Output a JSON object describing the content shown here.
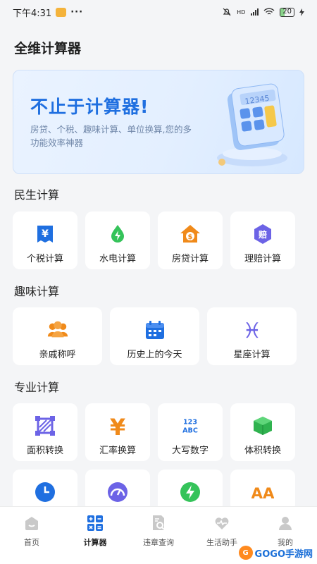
{
  "status": {
    "time": "下午4:31",
    "more": "···",
    "signal_label": "HD",
    "battery": "20"
  },
  "app": {
    "title": "全维计算器"
  },
  "banner": {
    "title": "不止于计算器!",
    "subtitle": "房贷、个税、趣味计算、单位换算,您的多功能效率神器",
    "display_text": "12345"
  },
  "sections": {
    "minsheng": {
      "title": "民生计算",
      "items": [
        {
          "label": "个税计算",
          "icon": "tax-icon",
          "color": "#1f6fe0",
          "glyph": "¥"
        },
        {
          "label": "水电计算",
          "icon": "utility-icon",
          "color": "#35c35a",
          "glyph": "⚡"
        },
        {
          "label": "房贷计算",
          "icon": "mortgage-icon",
          "color": "#f08a1a",
          "glyph": "$"
        },
        {
          "label": "理赔计算",
          "icon": "claim-icon",
          "color": "#6c63e6",
          "glyph": "赔"
        }
      ]
    },
    "quwei": {
      "title": "趣味计算",
      "items": [
        {
          "label": "亲戚称呼",
          "icon": "relatives-icon",
          "color": "#f08a1a"
        },
        {
          "label": "历史上的今天",
          "icon": "calendar-icon",
          "color": "#1f6fe0"
        },
        {
          "label": "星座计算",
          "icon": "pisces-icon",
          "color": "#6c63e6",
          "glyph": "♓"
        }
      ]
    },
    "zhuanye": {
      "title": "专业计算",
      "items": [
        {
          "label": "面积转换",
          "icon": "area-icon",
          "color": "#6c63e6"
        },
        {
          "label": "汇率换算",
          "icon": "exchange-icon",
          "color": "#f08a1a",
          "glyph": "¥"
        },
        {
          "label": "大写数字",
          "icon": "numbers-icon",
          "color": "#1f6fe0",
          "glyph_top": "123",
          "glyph_bottom": "ABC"
        },
        {
          "label": "体积转换",
          "icon": "volume-icon",
          "color": "#35c35a"
        }
      ],
      "more_items": [
        {
          "icon": "clock-icon",
          "color": "#1f6fe0"
        },
        {
          "icon": "gauge-icon",
          "color": "#6c63e6"
        },
        {
          "icon": "power-icon",
          "color": "#35c35a",
          "glyph": "⚡"
        },
        {
          "icon": "font-size-icon",
          "color": "#f08a1a",
          "glyph": "AA"
        }
      ]
    }
  },
  "tabbar": {
    "items": [
      {
        "label": "首页",
        "icon": "home-icon"
      },
      {
        "label": "计算器",
        "icon": "calculator-icon"
      },
      {
        "label": "违章查询",
        "icon": "violation-query-icon"
      },
      {
        "label": "生活助手",
        "icon": "heart-icon"
      },
      {
        "label": "我的",
        "icon": "profile-icon"
      }
    ]
  },
  "watermark": {
    "text": "GOGO手游网",
    "badge": "G"
  },
  "colors": {
    "blue": "#1f6fe0",
    "green": "#35c35a",
    "orange": "#f08a1a",
    "purple": "#6c63e6"
  }
}
